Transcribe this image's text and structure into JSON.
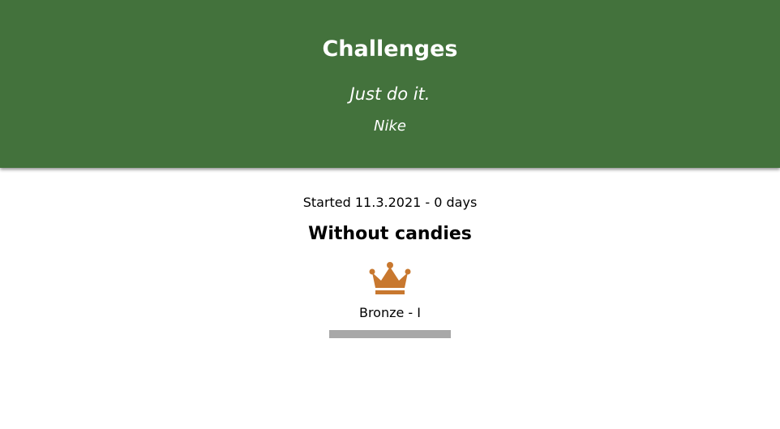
{
  "header": {
    "title": "Challenges",
    "quote": "Just do it.",
    "author": "Nike"
  },
  "challenge": {
    "started": "Started 11.3.2021 - 0 days",
    "name": "Without candies",
    "icon": "crown-icon",
    "level": "Bronze - I",
    "progress": 0
  },
  "colors": {
    "header_bg": "#43723c",
    "crown": "#c8782f",
    "progress_track": "#a8a8a8",
    "progress_fill": "#c8782f"
  }
}
